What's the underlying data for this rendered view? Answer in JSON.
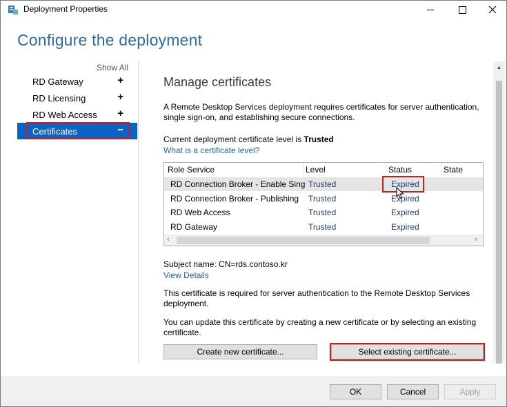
{
  "window": {
    "title": "Deployment Properties"
  },
  "header": {
    "title": "Configure the deployment"
  },
  "nav": {
    "show_all": "Show All",
    "items": [
      {
        "label": "RD Gateway",
        "symbol": "+"
      },
      {
        "label": "RD Licensing",
        "symbol": "+"
      },
      {
        "label": "RD Web Access",
        "symbol": "+"
      },
      {
        "label": "Certificates",
        "symbol": "−"
      }
    ]
  },
  "main": {
    "title": "Manage certificates",
    "intro": "A Remote Desktop Services deployment requires certificates for server authentication, single sign-on, and establishing secure connections.",
    "level_prefix": "Current deployment certificate level is ",
    "level_value": "Trusted",
    "level_link": "What is a certificate level?",
    "table": {
      "headers": [
        "Role Service",
        "Level",
        "Status",
        "State"
      ],
      "rows": [
        {
          "role": "RD Connection Broker - Enable Single Sign On",
          "level": "Trusted",
          "status": "Expired"
        },
        {
          "role": "RD Connection Broker - Publishing",
          "level": "Trusted",
          "status": "Expired"
        },
        {
          "role": "RD Web Access",
          "level": "Trusted",
          "status": "Expired"
        },
        {
          "role": "RD Gateway",
          "level": "Trusted",
          "status": "Expired"
        }
      ]
    },
    "subject": "Subject name: CN=rds.contoso.kr",
    "view_details": "View Details",
    "required_text": "This certificate is required for server authentication to the Remote Desktop Services deployment.",
    "update_text": "You can update this certificate by creating a new certificate or by selecting an existing certificate.",
    "create_button": "Create new certificate...",
    "select_button": "Select existing certificate..."
  },
  "footer": {
    "ok": "OK",
    "cancel": "Cancel",
    "apply": "Apply"
  },
  "colors": {
    "accent": "#0a64c8",
    "highlight": "#d11b1b",
    "header": "#2d6da3"
  }
}
